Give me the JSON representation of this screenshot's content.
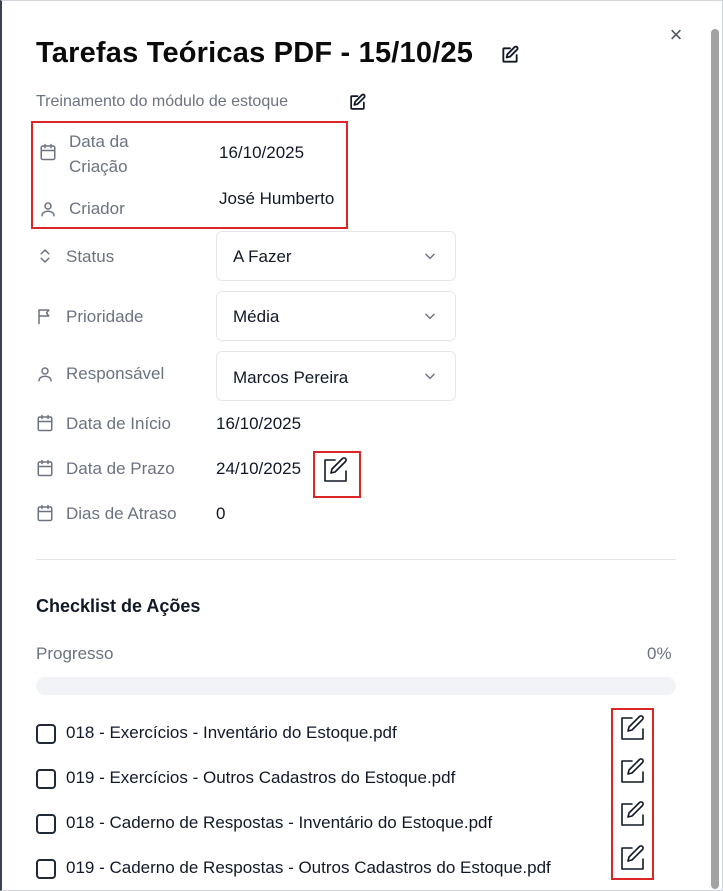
{
  "header": {
    "title": "Tarefas Teóricas PDF - 15/10/25",
    "subtitle": "Treinamento do módulo de estoque"
  },
  "icons": {
    "close": "close-icon",
    "edit": "pencil-square-icon",
    "calendar": "calendar-icon",
    "user": "user-icon",
    "status": "chevrons-up-down-icon",
    "flag": "flag-icon",
    "chevron": "chevron-down-icon"
  },
  "details": {
    "created_label": "Data da Criação",
    "created_label_l1": "Data da",
    "created_label_l2": "Criação",
    "created_value": "16/10/2025",
    "creator_label": "Criador",
    "creator_value": "José Humberto",
    "status_label": "Status",
    "status_value": "A Fazer",
    "priority_label": "Prioridade",
    "priority_value": "Média",
    "assignee_label": "Responsável",
    "assignee_value": "Marcos Pereira",
    "start_label": "Data de Início",
    "start_value": "16/10/2025",
    "due_label": "Data de Prazo",
    "due_value": "24/10/2025",
    "delay_label": "Dias de Atraso",
    "delay_value": "0"
  },
  "checklist": {
    "title": "Checklist de Ações",
    "progress_label": "Progresso",
    "progress_pct": "0%",
    "progress_value": 0,
    "items": [
      {
        "text": "018 - Exercícios - Inventário do Estoque.pdf",
        "checked": false
      },
      {
        "text": "019 - Exercícios - Outros Cadastros do Estoque.pdf",
        "checked": false
      },
      {
        "text": "018 - Caderno de Respostas - Inventário do Estoque.pdf",
        "checked": false
      },
      {
        "text": "019 - Caderno de Respostas - Outros Cadastros do Estoque.pdf",
        "checked": false
      }
    ]
  },
  "colors": {
    "highlight": "#dc2626",
    "muted_text": "#6b7280",
    "progress_track": "#f1f3f6"
  }
}
